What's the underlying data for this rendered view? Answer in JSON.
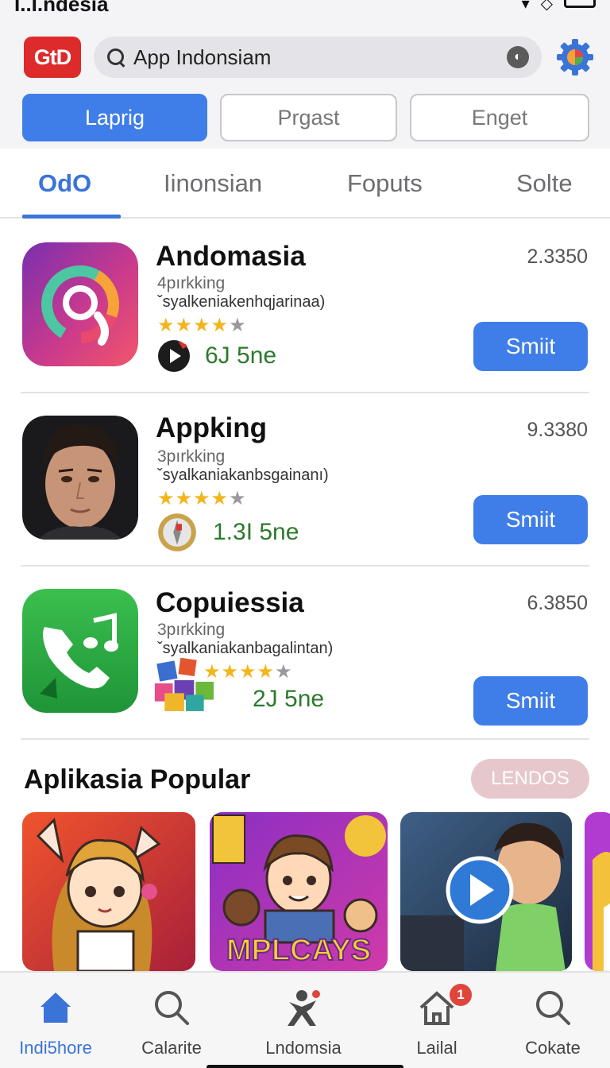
{
  "status": {
    "carrier": "I..I.ndesia"
  },
  "header": {
    "logo": "GtD",
    "search_text": "App Indonsiam",
    "chips": [
      "Laprig",
      "Prgast",
      "Enget"
    ]
  },
  "tabs": [
    "OdO",
    "Iinonsian",
    "Foputs",
    "Solte"
  ],
  "apps": [
    {
      "name": "Andomasia",
      "sub": "4pırkking",
      "desc": "ˇsyalkeniakenhqjarinaa)",
      "rating_stars": 4,
      "size": "6J 5ne",
      "price": "2.3350",
      "button": "Smiit"
    },
    {
      "name": "Appking",
      "sub": "3pırkking",
      "desc": "ˇsyalkaniakanbsgainanı)",
      "rating_stars": 4,
      "size": "1.3I 5ne",
      "price": "9.3380",
      "button": "Smiit"
    },
    {
      "name": "Copuiessia",
      "sub": "3pırkking",
      "desc": "ˇsyalkaniakanbagalintan)",
      "rating_stars": 4,
      "size": "2J 5ne",
      "price": "6.3850",
      "button": "Smiit"
    }
  ],
  "popular": {
    "title": "Aplikasia Popular",
    "more_label": "LENDOS",
    "card2_text": "MPLCAYS"
  },
  "nav": [
    {
      "label": "Indi5hore",
      "icon": "home-icon"
    },
    {
      "label": "Calarite",
      "icon": "search-icon"
    },
    {
      "label": "Lndomsia",
      "icon": "person-icon"
    },
    {
      "label": "Lailal",
      "icon": "house-icon",
      "badge": "1"
    },
    {
      "label": "Cokate",
      "icon": "search-icon"
    }
  ],
  "colors": {
    "accent": "#3f7ee8",
    "logo": "#dd2b2b",
    "star": "#f2b51c",
    "size_text": "#2c7a2c"
  }
}
